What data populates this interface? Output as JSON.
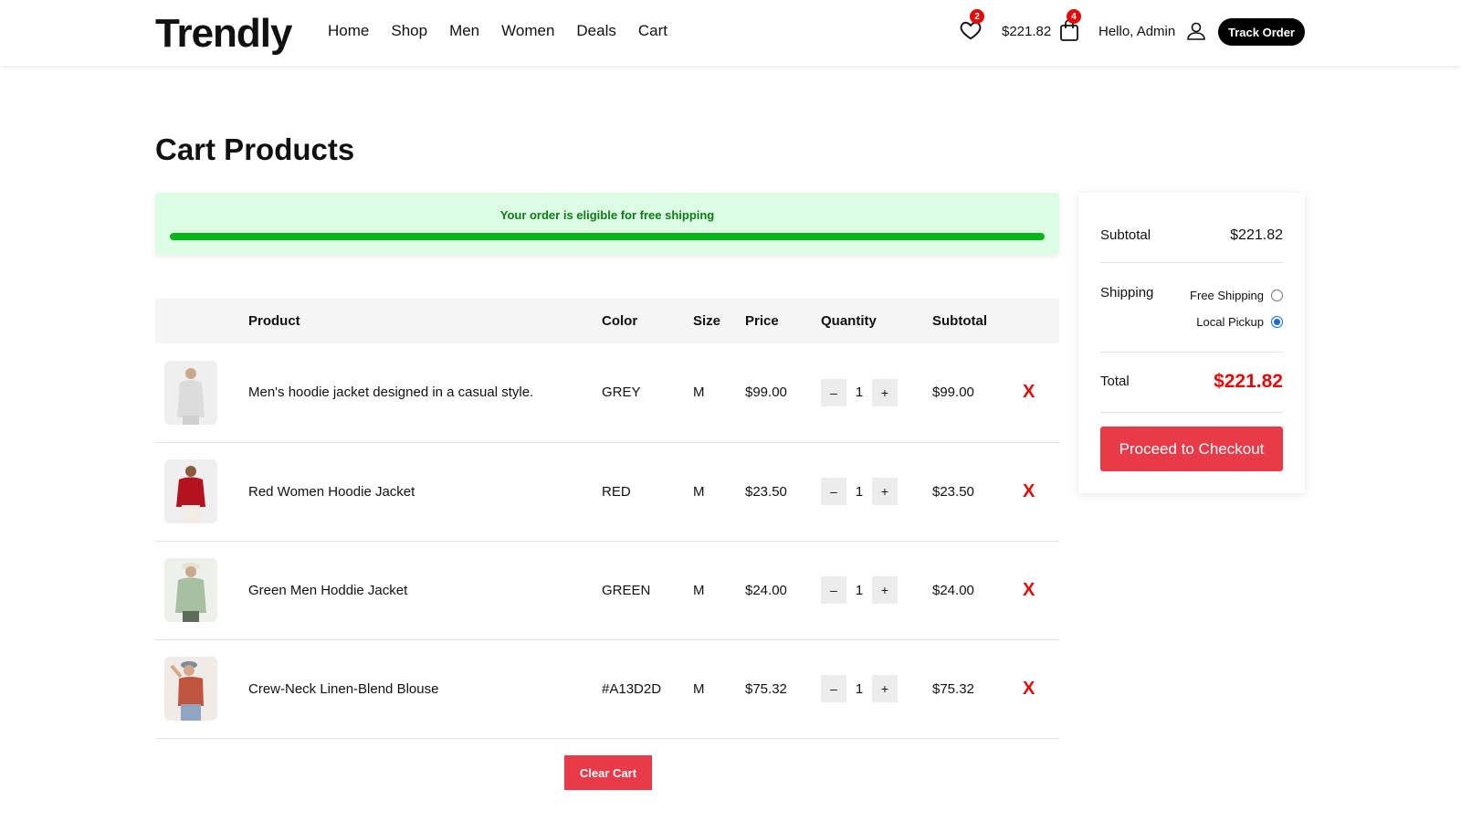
{
  "header": {
    "logo": "Trendly",
    "nav": [
      "Home",
      "Shop",
      "Men",
      "Women",
      "Deals",
      "Cart"
    ],
    "wishlist_count": "2",
    "cart_total": "$221.82",
    "cart_count": "4",
    "greeting": "Hello, Admin",
    "track_order_label": "Track Order",
    "icons": [
      "heart-icon",
      "shopping-bag-icon",
      "user-icon"
    ]
  },
  "page_title": "Cart Products",
  "shipping_banner": {
    "message": "Your order is eligible for free shipping",
    "progress": 1.0,
    "bar_color": "#08b518",
    "bg_color": "#dcfce3"
  },
  "table": {
    "headers": [
      "",
      "Product",
      "Color",
      "Size",
      "Price",
      "Quantity",
      "Subtotal",
      ""
    ],
    "rows": [
      {
        "product": "Men's hoodie jacket designed in a casual style.",
        "color": "GREY",
        "size": "M",
        "price": "$99.00",
        "quantity": "1",
        "subtotal": "$99.00",
        "remove": "X",
        "thumb_color": "#dcdcdc"
      },
      {
        "product": "Red Women Hoodie Jacket",
        "color": "RED",
        "size": "M",
        "price": "$23.50",
        "quantity": "1",
        "subtotal": "$23.50",
        "remove": "X",
        "thumb_color": "#b3121f"
      },
      {
        "product": "Green Men Hoddie Jacket",
        "color": "GREEN",
        "size": "M",
        "price": "$24.00",
        "quantity": "1",
        "subtotal": "$24.00",
        "remove": "X",
        "thumb_color": "#a8bfa2"
      },
      {
        "product": "Crew-Neck Linen-Blend Blouse",
        "color": "#A13D2D",
        "size": "M",
        "price": "$75.32",
        "quantity": "1",
        "subtotal": "$75.32",
        "remove": "X",
        "thumb_color": "#c1543f"
      }
    ],
    "qty_minus": "–",
    "qty_plus": "+"
  },
  "clear_cart_label": "Clear Cart",
  "summary": {
    "subtotal_label": "Subtotal",
    "subtotal_value": "$221.82",
    "shipping_label": "Shipping",
    "shipping_options": [
      {
        "label": "Free Shipping",
        "selected": false
      },
      {
        "label": "Local Pickup",
        "selected": true
      }
    ],
    "total_label": "Total",
    "total_value": "$221.82",
    "checkout_label": "Proceed to Checkout"
  },
  "colors": {
    "accent_red": "#e83a48",
    "price_red": "#e10b0b",
    "green": "#08b518"
  }
}
